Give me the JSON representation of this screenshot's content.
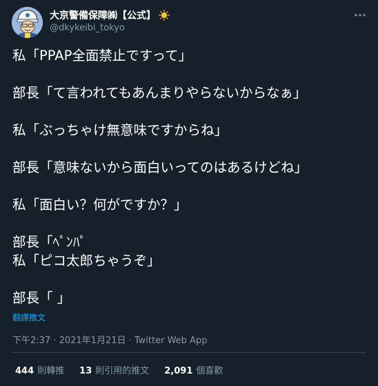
{
  "author": {
    "display_name": "大京警備保障㈱【公式】",
    "handle": "@dkykeibi_tokyo",
    "badge_icon": "sun-icon"
  },
  "tweet": {
    "lines": [
      "私「PPAP全面禁止ですって」",
      "",
      "部長「て言われてもあんまりやらないからなぁ」",
      "",
      "私「ぶっちゃけ無意味ですからね」",
      "",
      "部長「意味ないから面白いってのはあるけどね」",
      "",
      "私「面白い？何がですか？」",
      "",
      "部長「ﾍﾟﾝﾊﾟ",
      "私「ピコ太郎ちゃうぞ」",
      "",
      "部長「 」"
    ],
    "translate_label": "翻譯推文",
    "timestamp": "下午2:37 · 2021年1月21日 · Twitter Web App"
  },
  "stats": {
    "retweets": {
      "count": "444",
      "label": "則轉推"
    },
    "quotes": {
      "count": "13",
      "label": "則引用的推文"
    },
    "likes": {
      "count": "2,091",
      "label": "個喜歡"
    }
  },
  "colors": {
    "background": "#15202b",
    "text": "#ffffff",
    "secondary": "#8899a6",
    "link": "#1da1f2",
    "divider": "#38444d"
  }
}
